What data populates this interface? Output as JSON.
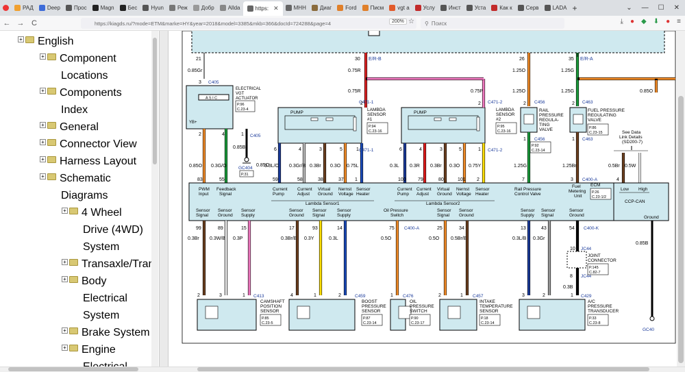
{
  "browser": {
    "tabs": [
      {
        "label": "РАД",
        "color": "#f0a030"
      },
      {
        "label": "Deep",
        "color": "#3d6bd8"
      },
      {
        "label": "Прос",
        "color": "#555555"
      },
      {
        "label": "Magn",
        "color": "#222222"
      },
      {
        "label": "Бес",
        "color": "#222222"
      },
      {
        "label": "Hyun",
        "color": "#555555"
      },
      {
        "label": "Реж",
        "color": "#777777"
      },
      {
        "label": "Добр",
        "color": "#999999"
      },
      {
        "label": "Allda",
        "color": "#888888"
      },
      {
        "label": "https:",
        "color": "#666666"
      },
      {
        "label": "МНН",
        "color": "#666666"
      },
      {
        "label": "Диаг",
        "color": "#8a6b3c"
      },
      {
        "label": "Ford",
        "color": "#e0802a"
      },
      {
        "label": "Писм",
        "color": "#e0802a"
      },
      {
        "label": "vgt a",
        "color": "#e25a2a"
      },
      {
        "label": "Услу",
        "color": "#c22a2a"
      },
      {
        "label": "Инст",
        "color": "#555555"
      },
      {
        "label": "Уста",
        "color": "#555555"
      },
      {
        "label": "Как к",
        "color": "#c22a2a"
      },
      {
        "label": "Серв",
        "color": "#555555"
      },
      {
        "label": "LADA",
        "color": "#555555"
      }
    ],
    "active_tab": 9,
    "new_tab": "+",
    "url": "https://kiagds.ru/?mode=ETM&marke=HY&year=2018&model=3385&mkb=366&docId=724288&page=4",
    "zoom": "200%",
    "search_placeholder": "Поиск",
    "nav": {
      "back": "←",
      "forward": "→",
      "reload": "C"
    },
    "window": {
      "min": "—",
      "max": "☐",
      "close": "✕",
      "chevron": "⌄"
    }
  },
  "sidebar": {
    "items": [
      {
        "label": "English",
        "cont": ""
      },
      {
        "label": "Component",
        "cont": "Locations"
      },
      {
        "label": "Components",
        "cont": "Index"
      },
      {
        "label": "General",
        "cont": ""
      },
      {
        "label": "Connector View",
        "cont": ""
      },
      {
        "label": "Harness Layout",
        "cont": ""
      },
      {
        "label": "Schematic",
        "cont": "Diagrams"
      },
      {
        "label": "4 Wheel",
        "cont": "Drive (4WD)",
        "cont2": "System"
      },
      {
        "label": "Transaxle/Tran",
        "cont": ""
      },
      {
        "label": "Body",
        "cont": "Electrical",
        "cont2": "System"
      },
      {
        "label": "Brake System",
        "cont": ""
      },
      {
        "label": "Engine",
        "cont": "Electrical"
      }
    ],
    "expander": "+"
  },
  "diagram": {
    "components": {
      "vgt": {
        "name1": "ELECTRICAL",
        "name2": "VGT",
        "name3": "ACTUATOR",
        "ref1": "P.96",
        "ref2": "C.23-4",
        "chip": "A S I C",
        "conn": "C405",
        "pin_plus": "YB+"
      },
      "lambda1": {
        "name1": "LAMBDA",
        "name2": "SENSOR",
        "name3": "#1",
        "ref1": "P.94",
        "ref2": "C.23-16",
        "pump": "PUMP",
        "conn": "C471-1"
      },
      "lambda2": {
        "name1": "LAMBDA",
        "name2": "SENSOR",
        "name3": "#2",
        "ref1": "P.95",
        "ref2": "C.23-16",
        "pump": "PUMP",
        "conn": "C471-2"
      },
      "rail_valve": {
        "name1": "RAIL",
        "name2": "PRESSURE",
        "name3": "REGULA-",
        "name4": "TING",
        "name5": "VALVE",
        "ref1": "P.92",
        "ref2": "C.23-14",
        "conn": "C456"
      },
      "fuel_valve": {
        "name1": "FUEL PRESSURE",
        "name2": "REGULATING",
        "name3": "VALVE",
        "ref1": "P.86",
        "ref2": "C.23-15",
        "conn": "C463"
      },
      "see_data": {
        "line1": "See Data",
        "line2": "Link Details",
        "line3": "(SD200-7)"
      },
      "gc404": {
        "label": "GC404",
        "ref": "P.31"
      },
      "ecm": {
        "name": "ECM",
        "ref1": "P.26",
        "ref2": "C.23-1/2",
        "ccp": "CCP-CAN",
        "low": "Low",
        "high": "High",
        "ground": "Ground",
        "conn_a": "C400-A",
        "conn_k": "C400-K"
      },
      "camshaft": {
        "name1": "CAMSHAFT",
        "name2": "POSITION",
        "name3": "SENSOR",
        "ref1": "P.85",
        "ref2": "C.23-5",
        "conn": "C413"
      },
      "boost": {
        "name1": "BOOST",
        "name2": "PRESSURE",
        "name3": "SENSOR",
        "ref1": "P.87",
        "ref2": "C.23-14",
        "conn": "C459"
      },
      "oilsw": {
        "name1": "OIL",
        "name2": "PRESSURE",
        "name3": "SWITCH",
        "ref1": "P.90",
        "ref2": "C.23-17",
        "conn": "C476"
      },
      "intake": {
        "name1": "INTAKE",
        "name2": "TEMPERATURE",
        "name3": "SENSOR",
        "ref1": "P.18",
        "ref2": "C.23-14",
        "conn": "C457"
      },
      "ac": {
        "name1": "A/C",
        "name2": "PRESSURE",
        "name3": "TRANSDUCER",
        "ref1": "P.33",
        "ref2": "C.23-8",
        "conn": "C429"
      },
      "joint": {
        "name1": "JOINT",
        "name2": "CONNECTOR",
        "ref1": "P.145",
        "ref2": "C.82-7",
        "conn": "JC44"
      },
      "gc40": {
        "label": "GC40"
      }
    },
    "top_pins": [
      {
        "pin": "21",
        "wire": "0.85Gr"
      },
      {
        "pin": "30",
        "wire": "E/R-B"
      },
      {
        "pin": "26",
        "wire": ""
      },
      {
        "pin": "35",
        "wire": "E/R-A"
      }
    ],
    "wires_mid": {
      "w075r_a": "0.75R",
      "w075r_b": "0.75R",
      "w075p": "0.75P",
      "w125o_a": "1.25O",
      "w125g_a": "1.25G",
      "w125o_b": "1.25O",
      "w125g_b": "1.25G",
      "w085o": "0.85O",
      "w085b": "0.85B"
    },
    "pin_labels_top": [
      "3",
      "1",
      "2",
      "4",
      "2",
      "2",
      "1",
      "2",
      "1"
    ],
    "ecm_top_pins": [
      {
        "pin": "83",
        "wire": "0.85O",
        "label": "PWM Input"
      },
      {
        "pin": "55",
        "wire": "0.3G/O",
        "label": "Feedback Signal"
      },
      {
        "pin": "59",
        "wire": "0.3L/O"
      },
      {
        "pin": "58",
        "wire": "0.3Gr/B"
      },
      {
        "pin": "38",
        "wire": "0.3Br"
      },
      {
        "pin": "37",
        "wire": "0.3O"
      },
      {
        "pin": "1",
        "wire": "0.75L"
      },
      {
        "pin": "100",
        "wire": "0.3L"
      },
      {
        "pin": "79",
        "wire": "0.3R"
      },
      {
        "pin": "80",
        "wire": "0.3Br"
      },
      {
        "pin": "101",
        "wire": "0.3O"
      },
      {
        "pin": "2",
        "wire": "0.75Y"
      },
      {
        "pin": "7",
        "wire": "1.25G"
      },
      {
        "pin": "3",
        "wire": "1.25Br"
      },
      {
        "pin": "4",
        "wire": "0.5Br"
      },
      {
        "pin": "",
        "wire": "0.5W"
      }
    ],
    "lambda_pin_nums": [
      "6",
      "4",
      "3",
      "5"
    ],
    "ecm_labels": {
      "current_pump": "Current Pump",
      "current_adjust": "Current Adjust",
      "virtual_ground": "Virtual Ground",
      "nernst_voltage": "Nernst Voltage",
      "sensor_heater": "Sensor Heater",
      "lambda1": "Lambda Sensor1",
      "lambda2": "Lambda Sensor2",
      "rail_pressure": "Rail Pressure Control Valve",
      "fuel_metering": "Fuel Metering Unit"
    },
    "ecm_bottom_labels": [
      "Sensor Signal",
      "Sensor Ground",
      "Sensor Supply",
      "Sensor Ground",
      "Sensor Signal",
      "Sensor Supply",
      "Oil Pressure Switch",
      "Sensor Signal",
      "Sensor Ground",
      "Sensor Supply",
      "Sensor Signal",
      "Sensor Ground"
    ],
    "ecm_bottom_pins": [
      {
        "pin": "99",
        "wire": "0.3Br"
      },
      {
        "pin": "89",
        "wire": "0.3W/B"
      },
      {
        "pin": "15",
        "wire": "0.3P"
      },
      {
        "pin": "17",
        "wire": "0.3Br/B"
      },
      {
        "pin": "93",
        "wire": "0.3Y"
      },
      {
        "pin": "14",
        "wire": "0.3L"
      },
      {
        "pin": "75",
        "wire": "0.5O"
      },
      {
        "pin": "25",
        "wire": "0.5O"
      },
      {
        "pin": "34",
        "wire": "0.5Br/B"
      },
      {
        "pin": "13",
        "wire": "0.3L/B"
      },
      {
        "pin": "43",
        "wire": "0.3Gr"
      },
      {
        "pin": "54",
        "wire": ""
      }
    ],
    "jc_pins": [
      "10",
      "8"
    ],
    "bottom_wires": {
      "w085b": "0.85B",
      "w03b": "0.3B"
    },
    "bottom_pin_labels": [
      "2",
      "3",
      "1",
      "4",
      "1",
      "2",
      "1",
      "2",
      "1",
      "3",
      "2",
      "1"
    ]
  }
}
